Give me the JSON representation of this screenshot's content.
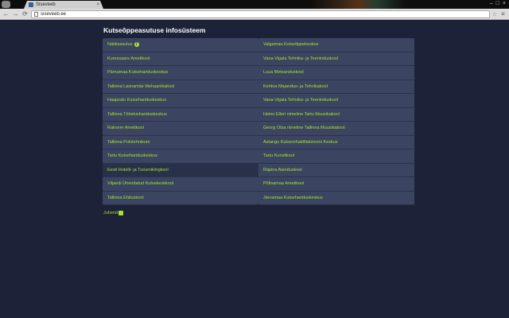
{
  "browser": {
    "tab_title": "Siseveeb",
    "tab_close": "×",
    "url": "siseveeb.ee",
    "nav": {
      "back": "←",
      "forward": "→",
      "reload": "⟳"
    },
    "star": "☆",
    "menu": "≡",
    "window_controls": [
      "–",
      "□",
      "×"
    ]
  },
  "page": {
    "title": "Kutseõppeasutuse infosüsteem",
    "left_column": [
      {
        "label": "Näidisasutus",
        "info": "i"
      },
      {
        "label": "Kuressaare Ametikool"
      },
      {
        "label": "Pärnumaa Kutsehariduskeskus"
      },
      {
        "label": "Tallinna Lasnamäe Mehaanikakool"
      },
      {
        "label": "Haapsalu Kutsehariduskeskus"
      },
      {
        "label": "Tallinna Tööstushariduskeskus"
      },
      {
        "label": "Rakvere Ametikool"
      },
      {
        "label": "Tallinna Polütehnikum"
      },
      {
        "label": "Tartu Kutsehariduskeskus"
      },
      {
        "label": "Eesti Hotelli- ja Turismikõrgkool",
        "active": true
      },
      {
        "label": "Viljandi Ühendatud Kutsekeskkool"
      },
      {
        "label": "Tallinna Ehituskool"
      }
    ],
    "right_column": [
      {
        "label": "Valgamaa Kutseõppekeskus"
      },
      {
        "label": "Vana-Vigala Tehnika- ja Teeninduskool"
      },
      {
        "label": "Luua Metsanduskool"
      },
      {
        "label": "Kehtna Majandus- ja Tehnikakool"
      },
      {
        "label": "Vana-Vigala Tehnika- ja Teeninduskool"
      },
      {
        "label": "Heino Elleri nimeline Tartu Muusikakool"
      },
      {
        "label": "Georg Otsa nimeline Tallinna Muusikakool"
      },
      {
        "label": "Astangu Kutserehabilitatsiooni Keskus"
      },
      {
        "label": "Tartu Kunstikool"
      },
      {
        "label": "Räpina Aianduskool"
      },
      {
        "label": "Põltsamaa Ametikool"
      },
      {
        "label": "Järvamaa Kutsehariduskeskus"
      }
    ],
    "help_link": "Juhend"
  }
}
